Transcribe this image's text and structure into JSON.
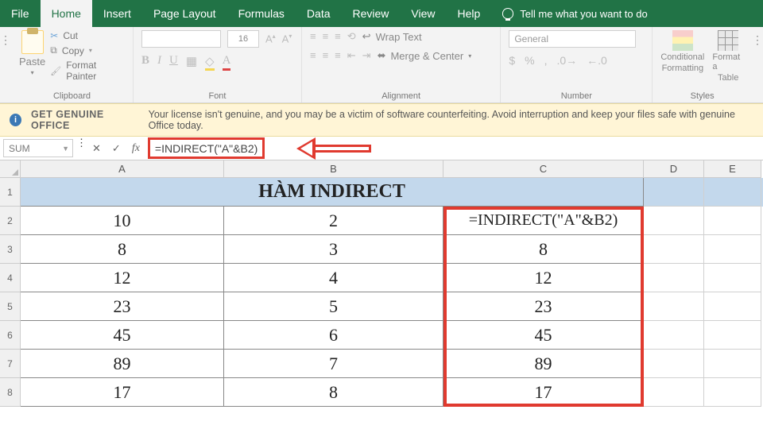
{
  "menu": {
    "tabs": [
      "File",
      "Home",
      "Insert",
      "Page Layout",
      "Formulas",
      "Data",
      "Review",
      "View",
      "Help"
    ],
    "active": "Home",
    "tell": "Tell me what you want to do"
  },
  "ribbon": {
    "clipboard": {
      "label": "Clipboard",
      "paste": "Paste",
      "cut": "Cut",
      "copy": "Copy",
      "painter": "Format Painter"
    },
    "font": {
      "label": "Font",
      "size": "16",
      "b": "B",
      "i": "I",
      "u": "U"
    },
    "alignment": {
      "label": "Alignment",
      "wrap": "Wrap Text",
      "merge": "Merge & Center"
    },
    "number": {
      "label": "Number",
      "format": "General"
    },
    "styles": {
      "label": "Styles",
      "cf": "Conditional",
      "cf2": "Formatting",
      "ft": "Format a",
      "ft2": "Table"
    }
  },
  "warning": {
    "title": "GET GENUINE OFFICE",
    "text": "Your license isn't genuine, and you may be a victim of software counterfeiting. Avoid interruption and keep your files safe with genuine Office today."
  },
  "fbar": {
    "name": "SUM",
    "formula": "=INDIRECT(\"A\"&B2)"
  },
  "cols": [
    "A",
    "B",
    "C",
    "D",
    "E"
  ],
  "rows": [
    "1",
    "2",
    "3",
    "4",
    "5",
    "6",
    "7",
    "8"
  ],
  "title": "HÀM INDIRECT",
  "data": {
    "A": [
      "10",
      "8",
      "12",
      "23",
      "45",
      "89",
      "17"
    ],
    "B": [
      "2",
      "3",
      "4",
      "5",
      "6",
      "7",
      "8"
    ],
    "C": [
      "=INDIRECT(\"A\"&B2)",
      "8",
      "12",
      "23",
      "45",
      "89",
      "17"
    ]
  },
  "chart_data": {
    "type": "table",
    "title": "HÀM INDIRECT",
    "columns": [
      "A",
      "B",
      "C"
    ],
    "rows": [
      {
        "A": 10,
        "B": 2,
        "C": "=INDIRECT(\"A\"&B2)"
      },
      {
        "A": 8,
        "B": 3,
        "C": 8
      },
      {
        "A": 12,
        "B": 4,
        "C": 12
      },
      {
        "A": 23,
        "B": 5,
        "C": 23
      },
      {
        "A": 45,
        "B": 6,
        "C": 45
      },
      {
        "A": 89,
        "B": 7,
        "C": 89
      },
      {
        "A": 17,
        "B": 8,
        "C": 17
      }
    ]
  }
}
